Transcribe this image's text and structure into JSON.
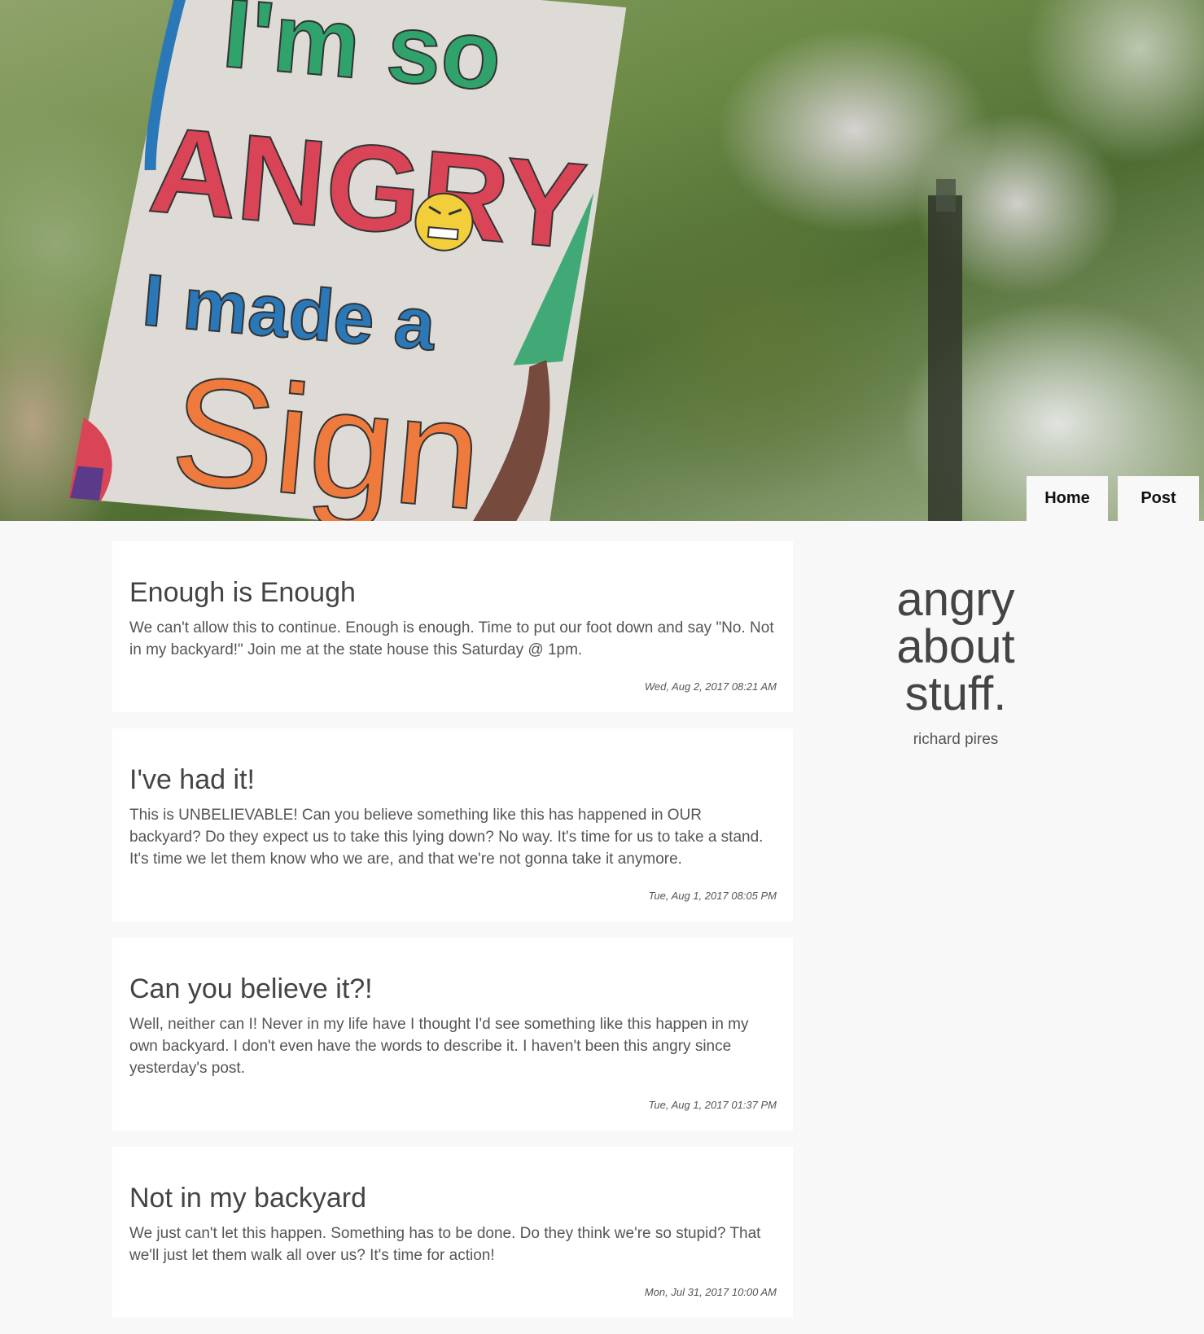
{
  "hero": {
    "sign_lines": [
      "I'm so",
      "ANGRY",
      "I made a",
      "Sign"
    ],
    "colors": {
      "sign": "#dedbd6",
      "green": "#2fa36b",
      "red": "#d94557",
      "blue": "#2a78b8",
      "orange": "#ef7a3d",
      "face": "#f2cf3a"
    }
  },
  "nav": {
    "home_label": "Home",
    "post_label": "Post"
  },
  "sidebar": {
    "title_line1": "angry",
    "title_line2": "about",
    "title_line3": "stuff.",
    "author": "richard pires"
  },
  "posts": [
    {
      "title": "Enough is Enough",
      "body": "We can't allow this to continue. Enough is enough. Time to put our foot down and say \"No. Not in my backyard!\" Join me at the state house this Saturday @ 1pm.",
      "date": "Wed, Aug 2, 2017 08:21 AM"
    },
    {
      "title": "I've had it!",
      "body": "This is UNBELIEVABLE! Can you believe something like this has happened in OUR backyard? Do they expect us to take this lying down? No way. It's time for us to take a stand. It's time we let them know who we are, and that we're not gonna take it anymore.",
      "date": "Tue, Aug 1, 2017 08:05 PM"
    },
    {
      "title": "Can you believe it?!",
      "body": "Well, neither can I! Never in my life have I thought I'd see something like this happen in my own backyard. I don't even have the words to describe it. I haven't been this angry since yesterday's post.",
      "date": "Tue, Aug 1, 2017 01:37 PM"
    },
    {
      "title": "Not in my backyard",
      "body": "We just can't let this happen. Something has to be done. Do they think we're so stupid? That we'll just let them walk all over us? It's time for action!",
      "date": "Mon, Jul 31, 2017 10:00 AM"
    }
  ]
}
